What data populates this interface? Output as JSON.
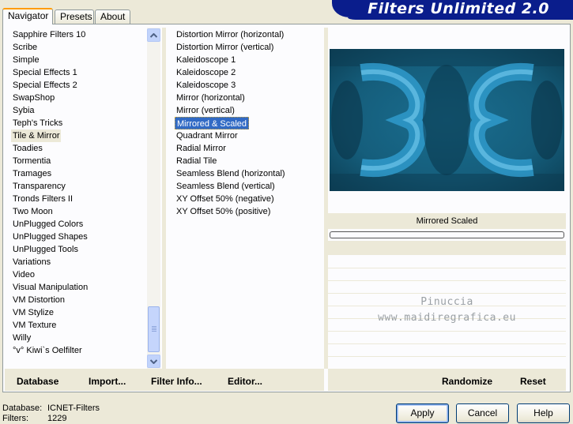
{
  "banner": {
    "title": "Filters Unlimited 2.0"
  },
  "tabs": [
    {
      "label": "Navigator",
      "active": true
    },
    {
      "label": "Presets",
      "active": false
    },
    {
      "label": "About",
      "active": false
    }
  ],
  "categories": {
    "items": [
      "Sapphire Filters 10",
      "Scribe",
      "Simple",
      "Special Effects 1",
      "Special Effects 2",
      "SwapShop",
      "Sybia",
      "Teph's Tricks",
      "Tile & Mirror",
      "Toadies",
      "Tormentia",
      "Tramages",
      "Transparency",
      "Tronds Filters II",
      "Two Moon",
      "UnPlugged Colors",
      "UnPlugged Shapes",
      "UnPlugged Tools",
      "Variations",
      "Video",
      "Visual Manipulation",
      "VM Distortion",
      "VM Stylize",
      "VM Texture",
      "Willy",
      "°v° Kiwi`s Oelfilter"
    ],
    "selected": "Tile & Mirror"
  },
  "filters": {
    "items": [
      "Distortion Mirror (horizontal)",
      "Distortion Mirror (vertical)",
      "Kaleidoscope 1",
      "Kaleidoscope 2",
      "Kaleidoscope 3",
      "Mirror (horizontal)",
      "Mirror (vertical)",
      "Mirrored & Scaled",
      "Quadrant Mirror",
      "Radial Mirror",
      "Radial Tile",
      "Seamless Blend (horizontal)",
      "Seamless Blend (vertical)",
      "XY Offset 50% (negative)",
      "XY Offset 50% (positive)"
    ],
    "selected": "Mirrored & Scaled"
  },
  "preview": {
    "filter_name": "Mirrored  Scaled",
    "watermark_line1": "Pinuccia",
    "watermark_line2": "www.maidiregrafica.eu",
    "colors": {
      "base": "#0f4d66",
      "highlight": "#3aa7d6",
      "dark": "#062433"
    }
  },
  "left_buttons": [
    "Database",
    "Import...",
    "Filter Info...",
    "Editor..."
  ],
  "right_buttons": [
    "Randomize",
    "Reset"
  ],
  "footer": {
    "database_label": "Database:",
    "database_value": "ICNET-Filters",
    "filters_label": "Filters:",
    "filters_value": "1229",
    "apply_label": "Apply",
    "cancel_label": "Cancel",
    "help_label": "Help"
  }
}
